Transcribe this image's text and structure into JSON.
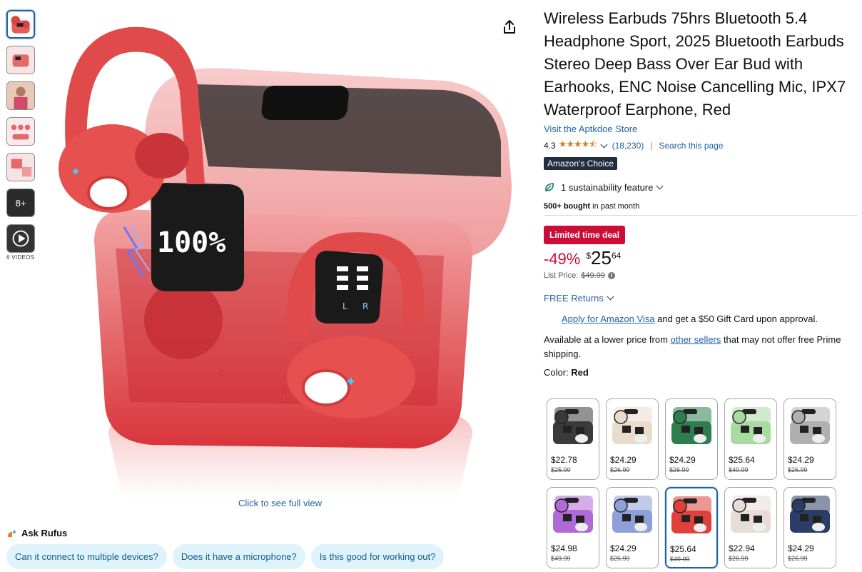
{
  "thumbnails": {
    "more_label": "8+",
    "videos_label": "6 VIDEOS"
  },
  "main_image": {
    "caption": "Click to see full view",
    "display_percent": "100%",
    "ear_left": "L",
    "ear_right": "R",
    "case_left": "L",
    "case_right": "R"
  },
  "rufus": {
    "title": "Ask Rufus",
    "chips": [
      "Can it connect to multiple devices?",
      "Does it have a microphone?",
      "Is this good for working out?"
    ]
  },
  "product": {
    "title": "Wireless Earbuds 75hrs Bluetooth 5.4 Headphone Sport, 2025 Bluetooth Earbuds Stereo Deep Bass Over Ear Bud with Earhooks, ENC Noise Cancelling Mic, IPX7 Waterproof Earphone, Red",
    "store_link": "Visit the Aptkdoe Store",
    "rating": "4.3",
    "stars": "★★★★⯪",
    "review_count": "(18,230)",
    "search_page": "Search this page",
    "badge": "Amazon's Choice",
    "sustainability": "1 sustainability feature",
    "bought_bold": "500+ bought",
    "bought_rest": " in past month",
    "deal_badge": "Limited time deal",
    "discount": "-49%",
    "currency": "$",
    "price_whole": "25",
    "price_fraction": "64",
    "list_price_label": "List Price:",
    "list_price": "$49.99",
    "returns": "FREE Returns",
    "visa_link": "Apply for Amazon Visa",
    "visa_rest": " and get a $50 Gift Card upon approval.",
    "lower_price_1": "Available at a lower price from ",
    "lower_price_link": "other sellers",
    "lower_price_2": " that may not offer free Prime shipping.",
    "color_label": "Color: ",
    "color_value": "Red"
  },
  "swatches": [
    {
      "price": "$22.78",
      "list": "$25.99",
      "color": "#3a3a3a"
    },
    {
      "price": "$24.29",
      "list": "$26.99",
      "color": "#e9dccd"
    },
    {
      "price": "$24.29",
      "list": "$26.99",
      "color": "#2e7d4f"
    },
    {
      "price": "$25.64",
      "list": "$49.99",
      "color": "#a8dba0"
    },
    {
      "price": "$24.29",
      "list": "$26.99",
      "color": "#b0b0b0"
    },
    {
      "price": "$24.98",
      "list": "$49.99",
      "color": "#b06ad6"
    },
    {
      "price": "$24.29",
      "list": "$26.99",
      "color": "#8f9fd8"
    },
    {
      "price": "$25.64",
      "list": "$49.99",
      "color": "#e0403c"
    },
    {
      "price": "$22.94",
      "list": "$26.99",
      "color": "#e8ddd6"
    },
    {
      "price": "$24.29",
      "list": "$26.99",
      "color": "#2b3d66"
    }
  ],
  "colors": {
    "accent_link": "#2162a1",
    "deal_red": "#cc0c39",
    "star": "#de7921",
    "product_red": "#e04444"
  }
}
